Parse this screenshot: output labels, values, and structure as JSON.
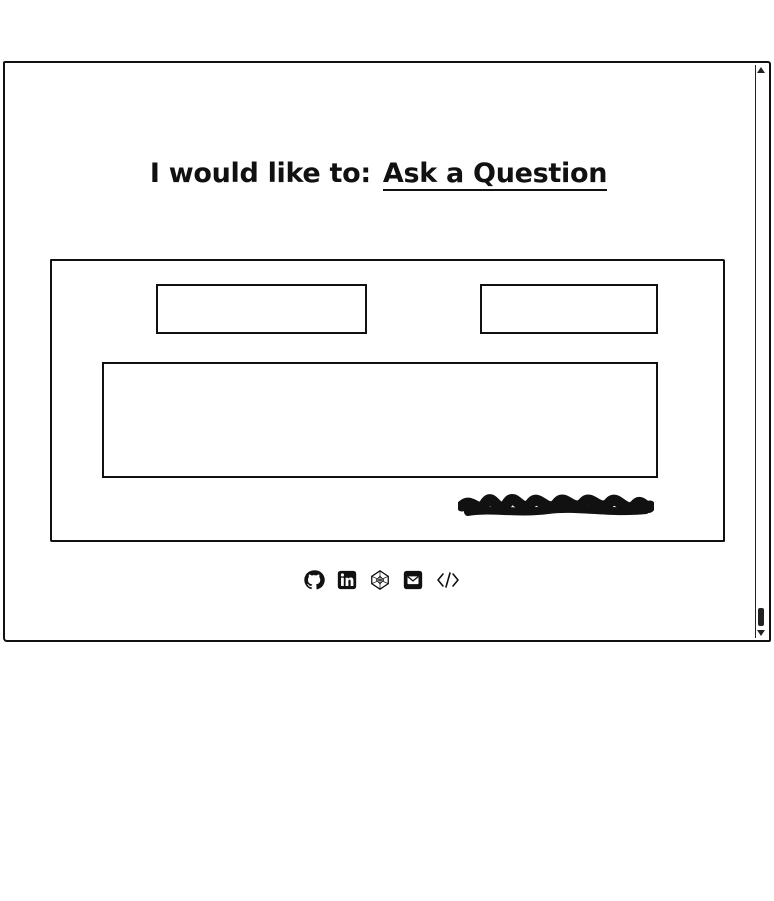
{
  "heading": {
    "prefix": "I would like to:",
    "selected_action": "Ask a Question"
  },
  "form": {
    "name_field_value": "",
    "email_field_value": "",
    "message_field_value": ""
  },
  "footer_icons": [
    "github-icon",
    "linkedin-icon",
    "codepen-icon",
    "email-icon",
    "code-icon"
  ],
  "colors": {
    "ink": "#111111",
    "background": "#ffffff"
  }
}
